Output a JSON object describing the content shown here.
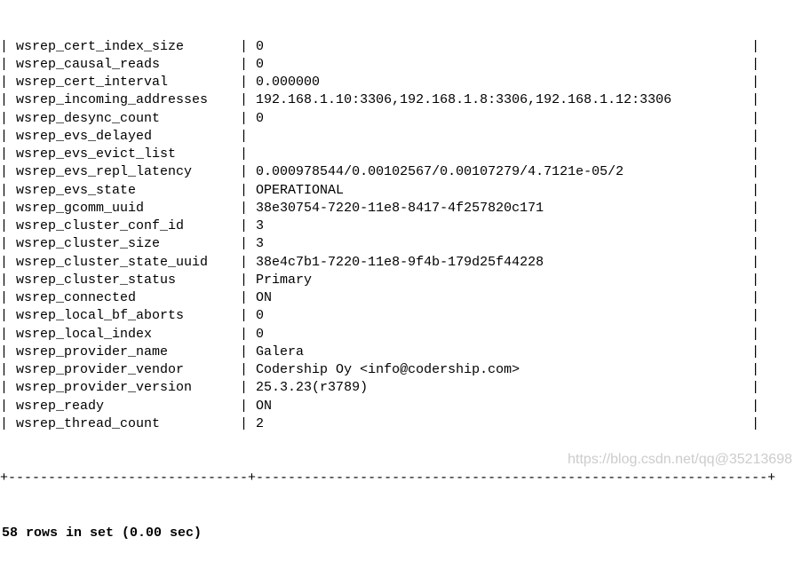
{
  "columns": {
    "col1_pad": 27,
    "col2_pad_char": " "
  },
  "rows": [
    {
      "name": "wsrep_cert_index_size",
      "value": "0"
    },
    {
      "name": "wsrep_causal_reads",
      "value": "0"
    },
    {
      "name": "wsrep_cert_interval",
      "value": "0.000000"
    },
    {
      "name": "wsrep_incoming_addresses",
      "value": "192.168.1.10:3306,192.168.1.8:3306,192.168.1.12:3306"
    },
    {
      "name": "wsrep_desync_count",
      "value": "0"
    },
    {
      "name": "wsrep_evs_delayed",
      "value": ""
    },
    {
      "name": "wsrep_evs_evict_list",
      "value": ""
    },
    {
      "name": "wsrep_evs_repl_latency",
      "value": "0.000978544/0.00102567/0.00107279/4.7121e-05/2"
    },
    {
      "name": "wsrep_evs_state",
      "value": "OPERATIONAL"
    },
    {
      "name": "wsrep_gcomm_uuid",
      "value": "38e30754-7220-11e8-8417-4f257820c171"
    },
    {
      "name": "wsrep_cluster_conf_id",
      "value": "3"
    },
    {
      "name": "wsrep_cluster_size",
      "value": "3"
    },
    {
      "name": "wsrep_cluster_state_uuid",
      "value": "38e4c7b1-7220-11e8-9f4b-179d25f44228"
    },
    {
      "name": "wsrep_cluster_status",
      "value": "Primary"
    },
    {
      "name": "wsrep_connected",
      "value": "ON"
    },
    {
      "name": "wsrep_local_bf_aborts",
      "value": "0"
    },
    {
      "name": "wsrep_local_index",
      "value": "0"
    },
    {
      "name": "wsrep_provider_name",
      "value": "Galera"
    },
    {
      "name": "wsrep_provider_vendor",
      "value": "Codership Oy <info@codership.com>"
    },
    {
      "name": "wsrep_provider_version",
      "value": "25.3.23(r3789)"
    },
    {
      "name": "wsrep_ready",
      "value": "ON"
    },
    {
      "name": "wsrep_thread_count",
      "value": "2"
    }
  ],
  "border": "+------------------------------+----------------------------------------------------------------+",
  "result_text": "58 rows in set (0.00 sec)",
  "watermark": "https://blog.csdn.net/qq@35213698"
}
